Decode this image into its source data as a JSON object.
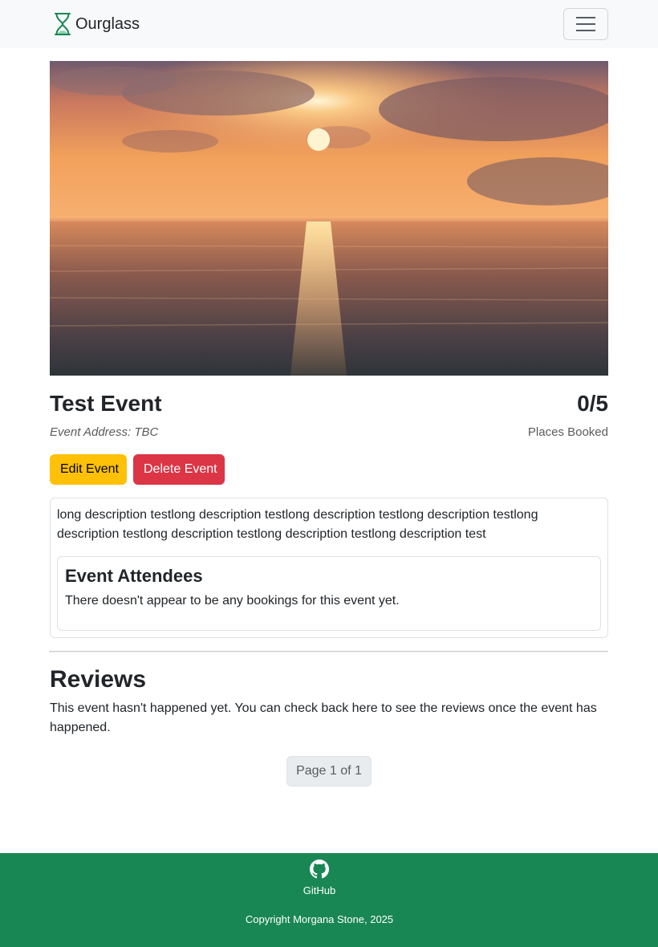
{
  "navbar": {
    "brand_name": "Ourglass",
    "brand_icon": "hourglass-icon",
    "menu_icon": "hamburger-menu-icon",
    "background": "#f8f9fa"
  },
  "event": {
    "hero_image": "sunset-over-sea",
    "title": "Test Event",
    "places_booked": "0/5",
    "places_booked_label": "Places Booked",
    "address": "Event Address: TBC",
    "description": "long description testlong description testlong description testlong description testlong description testlong description testlong description testlong description test"
  },
  "actions": {
    "edit_label": "Edit Event",
    "delete_label": "Delete Event",
    "edit_color": "#ffc107",
    "delete_color": "#dc3545"
  },
  "attendees": {
    "title": "Event Attendees",
    "empty_message": "There doesn't appear to be any bookings for this event yet."
  },
  "reviews": {
    "title": "Reviews",
    "message": "This event hasn't happened yet. You can check back here to see the reviews once the event has happened."
  },
  "pagination": {
    "label": "Page 1 of 1"
  },
  "footer": {
    "github_label": "GitHub",
    "github_icon": "github-icon",
    "copyright": "Copyright Morgana Stone, 2025",
    "background": "#198754"
  }
}
